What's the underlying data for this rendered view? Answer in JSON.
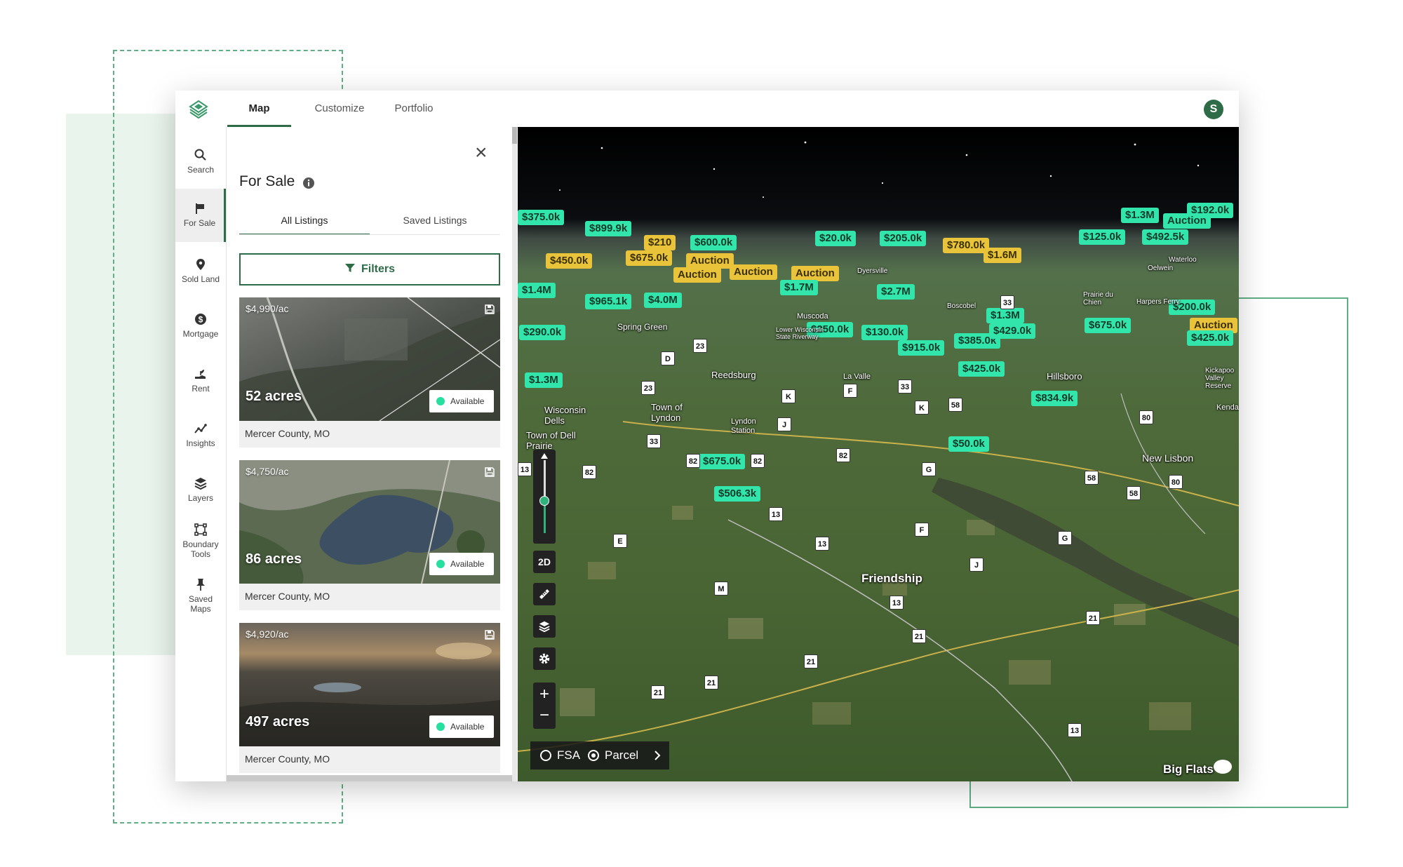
{
  "nav_tabs": [
    {
      "label": "Map",
      "active": true
    },
    {
      "label": "Customize",
      "active": false
    },
    {
      "label": "Portfolio",
      "active": false
    }
  ],
  "user": {
    "initial": "S"
  },
  "sidebar": {
    "items": [
      {
        "label": "Search",
        "icon": "search-icon"
      },
      {
        "label": "For Sale",
        "icon": "flag-icon",
        "active": true
      },
      {
        "label": "Sold Land",
        "icon": "map-pin-icon"
      },
      {
        "label": "Mortgage",
        "icon": "dollar-icon"
      },
      {
        "label": "Rent",
        "icon": "hand-sprout-icon"
      },
      {
        "label": "Insights",
        "icon": "trend-icon"
      },
      {
        "label": "Layers",
        "icon": "layers-icon"
      },
      {
        "label": "Boundary",
        "label2": "Tools",
        "icon": "boundary-icon"
      },
      {
        "label": "Saved",
        "label2": "Maps",
        "icon": "pin-icon"
      }
    ]
  },
  "panel": {
    "title": "For Sale",
    "tabs": [
      "All Listings",
      "Saved Listings"
    ],
    "filters_label": "Filters",
    "listings": [
      {
        "price": "$4,990/ac",
        "acres": "52 acres",
        "status": "Available",
        "location": "Mercer County, MO"
      },
      {
        "price": "$4,750/ac",
        "acres": "86 acres",
        "status": "Available",
        "location": "Mercer County, MO"
      },
      {
        "price": "$4,920/ac",
        "acres": "497 acres",
        "status": "Available",
        "location": "Mercer County, MO"
      }
    ]
  },
  "map": {
    "price_labels": [
      "$375.0k",
      "$899.9k",
      "$1.3M",
      "$192.0k",
      "Auction",
      "$210",
      "$600.0k",
      "$20.0k",
      "$205.0k",
      "$780.0k",
      "$125.0k",
      "$492.5k",
      "$450.0k",
      "$675.0k",
      "Auction",
      "$1.6M",
      "Auction",
      "Auction",
      "Auction",
      "$1.4M",
      "$965.1k",
      "$4.0M",
      "$1.7M",
      "$2.7M",
      "$1.3M",
      "$200.0k",
      "$290.0k",
      "$250.0k",
      "$130.0k",
      "$385.0k",
      "$429.0k",
      "$675.0k",
      "Auction",
      "$425.0k",
      "$915.0k",
      "$1.3M",
      "$425.0k",
      "$834.9k",
      "$50.0k",
      "$675.0k",
      "$506.3k"
    ],
    "towns": [
      "Dyersville",
      "Oelwein",
      "Waterloo",
      "Prairie du Chien",
      "Harpers Ferry",
      "Spring Green",
      "Boscobel",
      "Muscoda",
      "Lower Wisconsin State Riverway",
      "Reedsburg",
      "La Valle",
      "Hillsboro",
      "Kickapoo Valley Reserve",
      "Wisconsin Dells",
      "Town of Lyndon",
      "Lyndon Station",
      "Town of Dell Prairie",
      "New Lisbon",
      "Friendship",
      "Big Flats",
      "Kenda"
    ],
    "roads": [
      "23",
      "D",
      "33",
      "23",
      "K",
      "F",
      "K",
      "33",
      "58",
      "J",
      "33",
      "80",
      "13",
      "82",
      "82",
      "82",
      "82",
      "G",
      "58",
      "58",
      "80",
      "E",
      "13",
      "13",
      "F",
      "G",
      "J",
      "M",
      "13",
      "21",
      "21",
      "21",
      "21",
      "21",
      "13"
    ],
    "controls": {
      "mode_label": "2D"
    },
    "layer_toggle": {
      "options": [
        "FSA",
        "Parcel"
      ],
      "selected": "Parcel"
    }
  }
}
